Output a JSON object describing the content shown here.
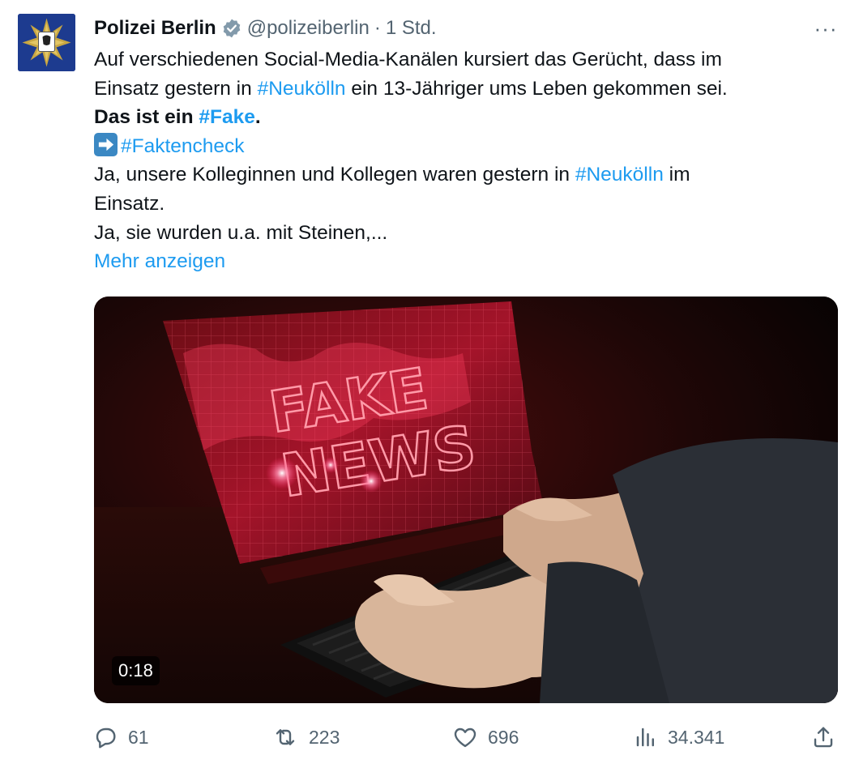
{
  "tweet": {
    "author": "Polizei Berlin",
    "handle": "@polizeiberlin",
    "separator": "·",
    "time": "1 Std.",
    "more_glyph": "···",
    "lines": {
      "l1": "Auf verschiedenen Social-Media-Kanälen kursiert das Gerücht, dass im",
      "l2_a": "Einsatz gestern in ",
      "l2_tag": "#Neukölln",
      "l2_b": " ein 13-Jähriger ums Leben gekommen sei.",
      "l3_a": "Das ist ein ",
      "l3_tag": "#Fake",
      "l3_b": ".",
      "l4_tag": "#Faktencheck",
      "l5_a": "Ja, unsere Kolleginnen und Kollegen waren gestern in ",
      "l5_tag": "#Neukölln",
      "l5_b": " im",
      "l6": "Einsatz.",
      "l7": "Ja, sie wurden u.a. mit Steinen,..."
    },
    "show_more": "Mehr anzeigen",
    "media": {
      "duration": "0:18",
      "screen_text_top": "FAKE",
      "screen_text_bottom": "NEWS"
    },
    "stats": {
      "replies": "61",
      "reposts": "223",
      "likes": "696",
      "views": "34.341"
    }
  },
  "icons": {
    "avatar": "berlin-police-star-icon",
    "verified": "verified-badge-icon",
    "arrow": "right-arrow-emoji",
    "reply": "reply-icon",
    "repost": "repost-icon",
    "like": "heart-icon",
    "views": "views-chart-icon",
    "share": "share-icon"
  },
  "colors": {
    "link": "#1d9bf0",
    "muted": "#536471",
    "text": "#0f1419",
    "avatar_bg": "#1d3b8f"
  }
}
